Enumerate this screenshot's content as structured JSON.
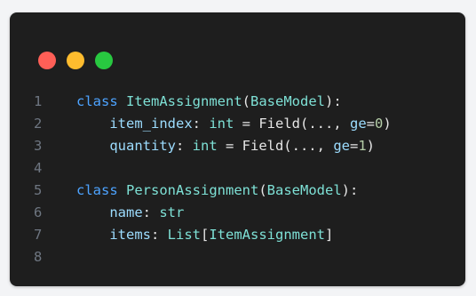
{
  "window": {
    "controls": [
      {
        "name": "close-button",
        "color": "#ff5f57"
      },
      {
        "name": "minimize-button",
        "color": "#febc2e"
      },
      {
        "name": "maximize-button",
        "color": "#28c840"
      }
    ]
  },
  "code": {
    "lines": [
      {
        "no": "1",
        "tokens": [
          {
            "t": "class",
            "k": "kw"
          },
          {
            "t": " ",
            "k": "txt"
          },
          {
            "t": "ItemAssignment",
            "k": "cls"
          },
          {
            "t": "(",
            "k": "txt"
          },
          {
            "t": "BaseModel",
            "k": "cls"
          },
          {
            "t": "):",
            "k": "txt"
          }
        ]
      },
      {
        "no": "2",
        "tokens": [
          {
            "t": "    ",
            "k": "txt"
          },
          {
            "t": "item_index",
            "k": "blue"
          },
          {
            "t": ": ",
            "k": "txt"
          },
          {
            "t": "int",
            "k": "cls"
          },
          {
            "t": " = Field(..., ",
            "k": "txt"
          },
          {
            "t": "ge",
            "k": "blue"
          },
          {
            "t": "=",
            "k": "txt"
          },
          {
            "t": "0",
            "k": "num"
          },
          {
            "t": ")",
            "k": "txt"
          }
        ]
      },
      {
        "no": "3",
        "tokens": [
          {
            "t": "    ",
            "k": "txt"
          },
          {
            "t": "quantity",
            "k": "blue"
          },
          {
            "t": ": ",
            "k": "txt"
          },
          {
            "t": "int",
            "k": "cls"
          },
          {
            "t": " = Field(..., ",
            "k": "txt"
          },
          {
            "t": "ge",
            "k": "blue"
          },
          {
            "t": "=",
            "k": "txt"
          },
          {
            "t": "1",
            "k": "num"
          },
          {
            "t": ")",
            "k": "txt"
          }
        ]
      },
      {
        "no": "4",
        "tokens": []
      },
      {
        "no": "5",
        "tokens": [
          {
            "t": "class",
            "k": "kw"
          },
          {
            "t": " ",
            "k": "txt"
          },
          {
            "t": "PersonAssignment",
            "k": "cls"
          },
          {
            "t": "(",
            "k": "txt"
          },
          {
            "t": "BaseModel",
            "k": "cls"
          },
          {
            "t": "):",
            "k": "txt"
          }
        ]
      },
      {
        "no": "6",
        "tokens": [
          {
            "t": "    ",
            "k": "txt"
          },
          {
            "t": "name",
            "k": "blue"
          },
          {
            "t": ": ",
            "k": "txt"
          },
          {
            "t": "str",
            "k": "cls"
          }
        ]
      },
      {
        "no": "7",
        "tokens": [
          {
            "t": "    ",
            "k": "txt"
          },
          {
            "t": "items",
            "k": "blue"
          },
          {
            "t": ": ",
            "k": "txt"
          },
          {
            "t": "List",
            "k": "cls"
          },
          {
            "t": "[",
            "k": "txt"
          },
          {
            "t": "ItemAssignment",
            "k": "cls"
          },
          {
            "t": "]",
            "k": "txt"
          }
        ]
      },
      {
        "no": "8",
        "tokens": []
      }
    ]
  }
}
